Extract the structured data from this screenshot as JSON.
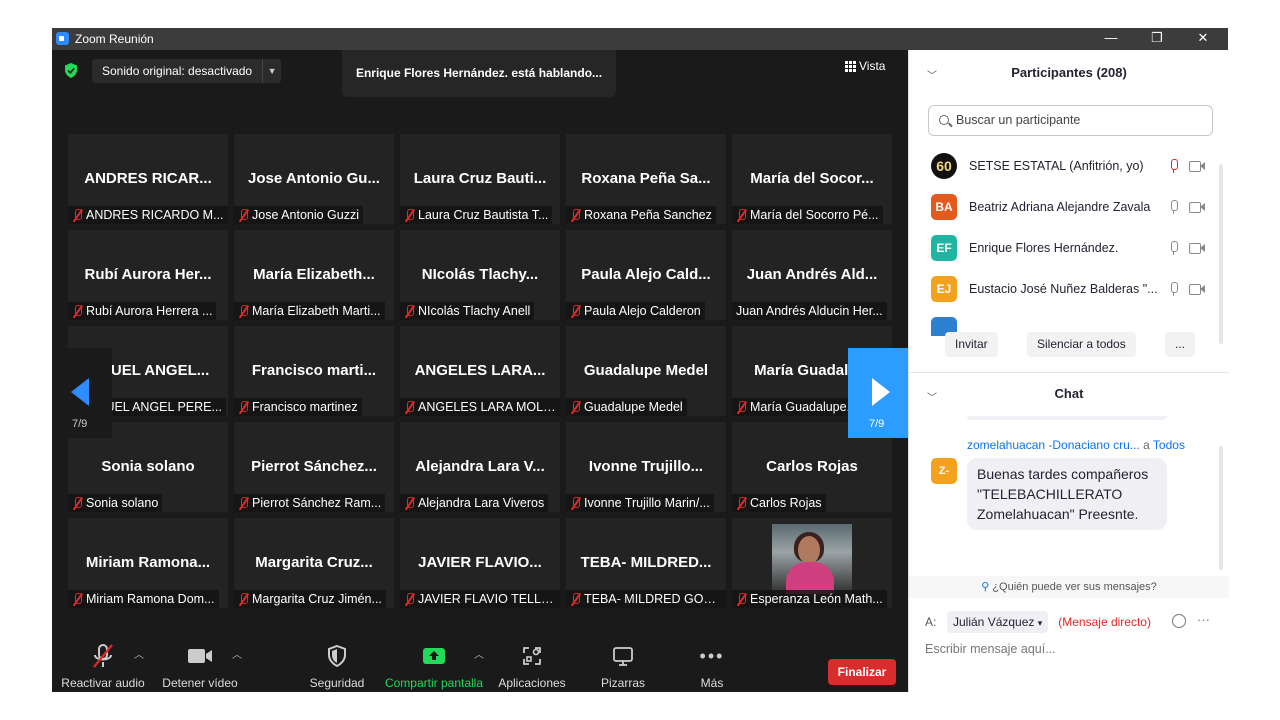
{
  "window": {
    "title": "Zoom Reunión",
    "minimize": "—",
    "restore": "❐",
    "close": "✕"
  },
  "meeting": {
    "sound_label": "Sonido original: desactivado",
    "speaking": "Enrique Flores Hernández. está hablando...",
    "view_label": "Vista",
    "page_indicator": "7/9"
  },
  "tiles": [
    {
      "big": "ANDRES RICAR...",
      "caption": "ANDRES RICARDO M..."
    },
    {
      "big": "Jose Antonio Gu...",
      "caption": "Jose Antonio Guzzi"
    },
    {
      "big": "Laura Cruz Bauti...",
      "caption": "Laura Cruz Bautista T..."
    },
    {
      "big": "Roxana Peña Sa...",
      "caption": "Roxana Peña Sanchez"
    },
    {
      "big": "María del Socor...",
      "caption": "María del Socorro Pé..."
    },
    {
      "big": "Rubí Aurora Her...",
      "caption": "Rubí Aurora Herrera ..."
    },
    {
      "big": "María Elizabeth...",
      "caption": "María Elizabeth Marti..."
    },
    {
      "big": "NIcolás Tlachy...",
      "caption": "NIcolás Tlachy Anell"
    },
    {
      "big": "Paula Alejo Cald...",
      "caption": "Paula Alejo Calderon"
    },
    {
      "big": "Juan Andrés Ald...",
      "caption": "Juan Andrés Alducin Her..."
    },
    {
      "big": "JIGUEL ANGEL...",
      "caption": "JIGUEL ANGEL PERE..."
    },
    {
      "big": "Francisco marti...",
      "caption": "Francisco martinez"
    },
    {
      "big": "ANGELES LARA...",
      "caption": "ANGELES LARA MOLI..."
    },
    {
      "big": "Guadalupe Medel",
      "caption": "Guadalupe Medel"
    },
    {
      "big": "María Guadalu...",
      "caption": "María Guadalupe..."
    },
    {
      "big": "Sonia solano",
      "caption": "Sonia solano"
    },
    {
      "big": "Pierrot Sánchez...",
      "caption": "Pierrot Sánchez Ram..."
    },
    {
      "big": "Alejandra Lara V...",
      "caption": "Alejandra Lara Viveros"
    },
    {
      "big": "Ivonne Trujillo...",
      "caption": "Ivonne Trujillo Marin/..."
    },
    {
      "big": "Carlos Rojas",
      "caption": "Carlos Rojas"
    },
    {
      "big": "Miriam Ramona...",
      "caption": "Miriam Ramona Dom..."
    },
    {
      "big": "Margarita Cruz...",
      "caption": "Margarita Cruz Jimén..."
    },
    {
      "big": "JAVIER FLAVIO...",
      "caption": "JAVIER FLAVIO TELLO ..."
    },
    {
      "big": "TEBA- MILDRED...",
      "caption": "TEBA- MILDRED GON..."
    },
    {
      "big": "",
      "caption": "Esperanza León Math..."
    }
  ],
  "toolbar": {
    "audio": "Reactivar audio",
    "video": "Detener vídeo",
    "security": "Seguridad",
    "share": "Compartir pantalla",
    "apps": "Aplicaciones",
    "whiteboards": "Pizarras",
    "more": "Más",
    "end": "Finalizar"
  },
  "participants": {
    "header": "Participantes (208)",
    "search_placeholder": "Buscar un participante",
    "list": [
      {
        "initials": "60",
        "name": "SETSE ESTATAL (Anfitrión, yo)",
        "color": "#111111"
      },
      {
        "initials": "BA",
        "name": "Beatriz Adriana Alejandre Zavala",
        "color": "#e35a1e"
      },
      {
        "initials": "EF",
        "name": "Enrique Flores Hernández.",
        "color": "#1fb5a0"
      },
      {
        "initials": "EJ",
        "name": "Eustacio José Nuñez Balderas \"...",
        "color": "#f4a21d"
      }
    ],
    "invite": "Invitar",
    "mute_all": "Silenciar a todos",
    "more": "..."
  },
  "chat": {
    "header": "Chat",
    "message": {
      "from": "zomelahuacan -Donaciano cru...",
      "to_word": "a",
      "to": "Todos",
      "avatar": "Z-",
      "text": "Buenas tardes compañeros \"TELEBACHILLERATO Zomelahuacan\" Preesnte."
    },
    "who_can_see": "¿Quién puede ver sus mensajes?",
    "to_label": "A:",
    "recipient": "Julián Vázquez",
    "direct": "(Mensaje directo)",
    "input_placeholder": "Escribir mensaje aquí..."
  }
}
